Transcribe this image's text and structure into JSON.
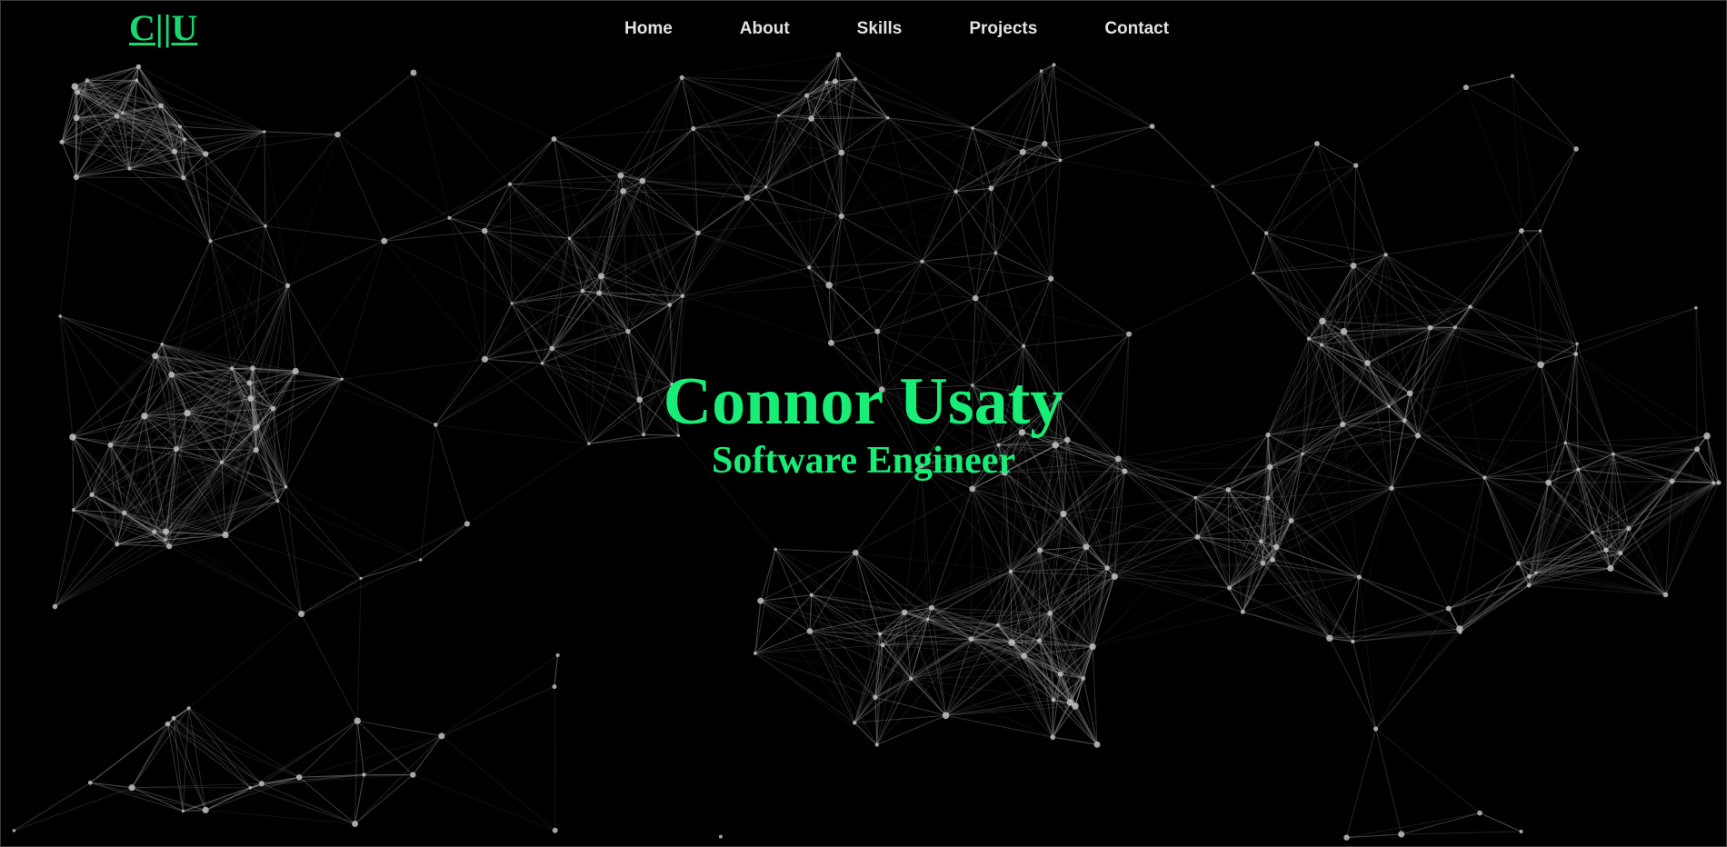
{
  "header": {
    "logo": "C||U",
    "nav": [
      "Home",
      "About",
      "Skills",
      "Projects",
      "Contact"
    ]
  },
  "hero": {
    "name": "Connor Usaty",
    "title": "Software Engineer"
  },
  "colors": {
    "background": "#000000",
    "accent": "#18ED78",
    "nav_text": "#E2E2E2",
    "network_line": "#8C8C8C",
    "network_node": "#BEBEBE"
  },
  "background": {
    "effect": "particle-network"
  }
}
